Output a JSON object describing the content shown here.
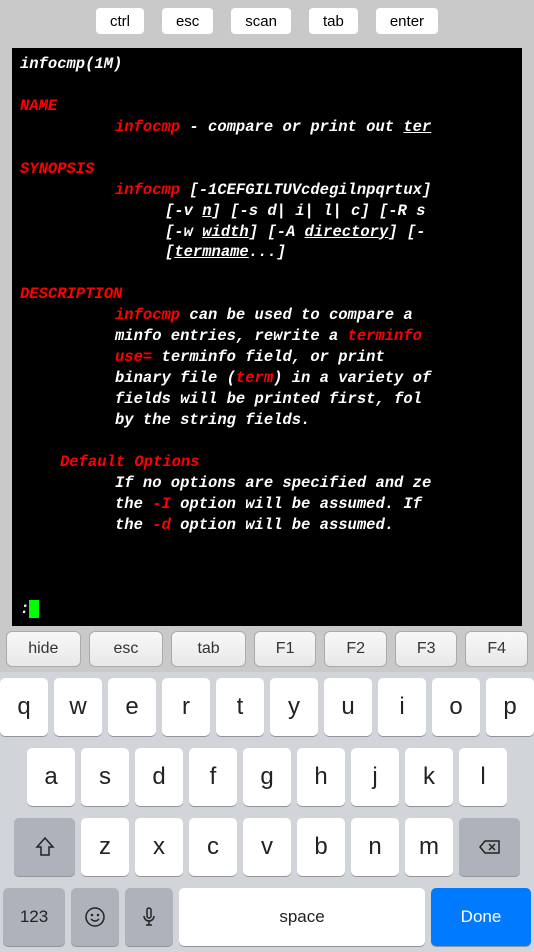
{
  "topButtons": {
    "ctrl": "ctrl",
    "esc": "esc",
    "scan": "scan",
    "tab": "tab",
    "enter": "enter"
  },
  "terminal": {
    "title": "infocmp(1M)",
    "nameHeader": "NAME",
    "nameCmd": "infocmp",
    "nameDesc": " - compare or print out ",
    "nameDescUL": "ter",
    "synopsisHeader": "SYNOPSIS",
    "syn_cmd": "infocmp",
    "syn_opts1": " [-1CEFGILTUVcdegilnpqrtux]",
    "syn_l2a": "[-v ",
    "syn_l2b": "n",
    "syn_l2c": "] [-s d| i| l| c] [-R s",
    "syn_l3a": "[-w ",
    "syn_l3b": "width",
    "syn_l3c": "] [-A ",
    "syn_l3d": "directory",
    "syn_l3e": "] [-",
    "syn_l4a": "[",
    "syn_l4b": "termname",
    "syn_l4c": "...]",
    "descHeader": "DESCRIPTION",
    "desc_cmd": "infocmp",
    "desc_l1": "  can be used to compare a ",
    "desc_l2a": "minfo entries, rewrite a ",
    "desc_l2b": "terminfo",
    "desc_l3a": "use=",
    "desc_l3b": "  terminfo  field,  or  print ",
    "desc_l4a": "binary file (",
    "desc_l4b": "term",
    "desc_l4c": ") in a variety of",
    "desc_l5": "fields  will be printed first, fol",
    "desc_l6": "by the string fields.",
    "defaultHeader": "Default Options",
    "def_l1": "If no options are specified and ze",
    "def_l2a": "the ",
    "def_l2b": "-I",
    "def_l2c": " option will be assumed.  If",
    "def_l3a": "the ",
    "def_l3b": "-d",
    "def_l3c": " option will be assumed.",
    "prompt": ":"
  },
  "fnKeys": {
    "hide": "hide",
    "esc": "esc",
    "tab": "tab",
    "f1": "F1",
    "f2": "F2",
    "f3": "F3",
    "f4": "F4"
  },
  "keys": {
    "r1": [
      "q",
      "w",
      "e",
      "r",
      "t",
      "y",
      "u",
      "i",
      "o",
      "p"
    ],
    "r2": [
      "a",
      "s",
      "d",
      "f",
      "g",
      "h",
      "j",
      "k",
      "l"
    ],
    "r3": [
      "z",
      "x",
      "c",
      "v",
      "b",
      "n",
      "m"
    ],
    "num": "123",
    "space": "space",
    "done": "Done"
  }
}
